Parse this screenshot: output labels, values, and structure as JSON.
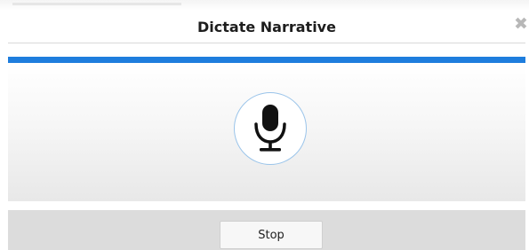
{
  "dialog": {
    "title": "Dictate Narrative",
    "close_glyph": "✖",
    "close_icon": "close-icon"
  },
  "progress": {
    "value": 1.0,
    "color": "#1e7ddd"
  },
  "mic": {
    "icon": "microphone-icon",
    "ring_color": "#9ac4ea"
  },
  "footer": {
    "stop_label": "Stop"
  }
}
